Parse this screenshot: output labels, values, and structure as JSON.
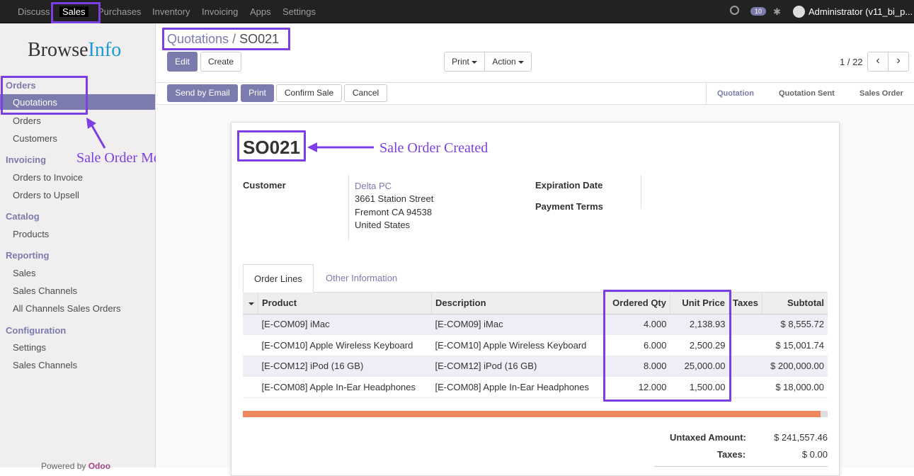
{
  "topbar": {
    "menus": [
      "Discuss",
      "Sales",
      "Purchases",
      "Inventory",
      "Invoicing",
      "Apps",
      "Settings"
    ],
    "chat_count": "10",
    "user": "Administrator (v11_bi_p..."
  },
  "sidebar": {
    "logo_a": "Browse",
    "logo_b": "Info",
    "sections": [
      {
        "title": "Orders",
        "items": [
          "Quotations",
          "Orders",
          "Customers"
        ]
      },
      {
        "title": "Invoicing",
        "items": [
          "Orders to Invoice",
          "Orders to Upsell"
        ]
      },
      {
        "title": "Catalog",
        "items": [
          "Products"
        ]
      },
      {
        "title": "Reporting",
        "items": [
          "Sales",
          "Sales Channels",
          "All Channels Sales Orders"
        ]
      },
      {
        "title": "Configuration",
        "items": [
          "Settings",
          "Sales Channels"
        ]
      }
    ],
    "powered_prefix": "Powered by ",
    "powered_brand": "Odoo"
  },
  "breadcrumb": {
    "parent": "Quotations",
    "sep": "/",
    "current": "SO021"
  },
  "buttons": {
    "edit": "Edit",
    "create": "Create",
    "print": "Print",
    "action": "Action",
    "send_email": "Send by Email",
    "print2": "Print",
    "confirm": "Confirm Sale",
    "cancel": "Cancel"
  },
  "pager": "1 / 22",
  "stages": [
    "Quotation",
    "Quotation Sent",
    "Sales Order"
  ],
  "order": {
    "name": "SO021",
    "customer_label": "Customer",
    "customer_name": "Delta PC",
    "addr1": "3661 Station Street",
    "addr2": "Fremont CA 94538",
    "addr3": "United States",
    "expiration_label": "Expiration Date",
    "payment_label": "Payment Terms"
  },
  "tabs": [
    "Order Lines",
    "Other Information"
  ],
  "columns": [
    "Product",
    "Description",
    "Ordered Qty",
    "Unit Price",
    "Taxes",
    "Subtotal"
  ],
  "lines": [
    [
      "[E-COM09] iMac",
      "[E-COM09] iMac",
      "4.000",
      "2,138.93",
      "",
      "$ 8,555.72"
    ],
    [
      "[E-COM10] Apple Wireless Keyboard",
      "[E-COM10] Apple Wireless Keyboard",
      "6.000",
      "2,500.29",
      "",
      "$ 15,001.74"
    ],
    [
      "[E-COM12] iPod (16 GB)",
      "[E-COM12] iPod (16 GB)",
      "8.000",
      "25,000.00",
      "",
      "$ 200,000.00"
    ],
    [
      "[E-COM08] Apple In-Ear Headphones",
      "[E-COM08] Apple In-Ear Headphones",
      "12.000",
      "1,500.00",
      "",
      "$ 18,000.00"
    ]
  ],
  "totals": {
    "untaxed_label": "Untaxed Amount:",
    "untaxed": "$ 241,557.46",
    "taxes_label": "Taxes:",
    "taxes": "$ 0.00"
  },
  "annotations": {
    "menu": "Sale Order Menu",
    "created": "Sale Order Created"
  },
  "colors": {
    "accent": "#7c7bad",
    "highlight": "#7c3fe4",
    "progress": "#f0865e"
  }
}
